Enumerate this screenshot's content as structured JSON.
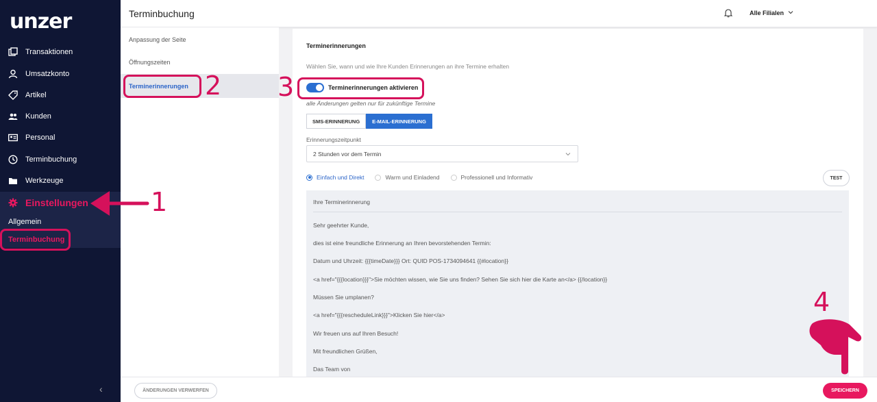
{
  "sidebar": {
    "logo": "unzer",
    "items": [
      {
        "label": "Transaktionen",
        "icon": "transactions-icon"
      },
      {
        "label": "Umsatzkonto",
        "icon": "user-icon"
      },
      {
        "label": "Artikel",
        "icon": "tag-icon"
      },
      {
        "label": "Kunden",
        "icon": "customers-icon"
      },
      {
        "label": "Personal",
        "icon": "id-card-icon"
      },
      {
        "label": "Terminbuchung",
        "icon": "clock-icon"
      },
      {
        "label": "Werkzeuge",
        "icon": "folder-icon"
      },
      {
        "label": "Einstellungen",
        "icon": "gear-icon"
      }
    ],
    "subitems": [
      {
        "label": "Allgemein"
      },
      {
        "label": "Terminbuchung"
      }
    ],
    "collapse_glyph": "‹"
  },
  "header": {
    "title": "Terminbuchung",
    "branch_selector": "Alle Filialen"
  },
  "subnav": {
    "items": [
      {
        "label": "Anpassung der Seite"
      },
      {
        "label": "Öffnungszeiten"
      },
      {
        "label": "Terminerinnerungen"
      }
    ]
  },
  "main": {
    "section_title": "Terminerinnerungen",
    "section_description": "Wählen Sie, wann und wie Ihre Kunden Erinnerungen an ihre Termine erhalten",
    "toggle_label": "Terminerinnerungen aktivieren",
    "toggle_on": true,
    "toggle_note": "alle Änderungen gelten nur für zukünftige Termine",
    "tabs": [
      {
        "label": "SMS-ERINNERUNG"
      },
      {
        "label": "E-MAIL-ERINNERUNG"
      }
    ],
    "timing_label": "Erinnerungszeitpunkt",
    "timing_value": "2 Stunden vor dem Termin",
    "templates": [
      {
        "label": "Einfach und Direkt"
      },
      {
        "label": "Warm und Einladend"
      },
      {
        "label": "Professionell und Informativ"
      }
    ],
    "test_label": "TEST",
    "email": {
      "subject": "Ihre Terminerinnerung",
      "lines": [
        "Sehr geehrter Kunde,",
        "dies ist eine freundliche Erinnerung an Ihren bevorstehenden Termin:",
        "Datum und Uhrzeit: {{{timeDate}}} Ort: QUID POS-1734094641 {{#location}}",
        "<a href=\"{{{location}}}\">Sie möchten wissen, wie Sie uns finden? Sehen Sie sich hier die Karte an</a> {{/location}}",
        "Müssen Sie umplanen?",
        "<a href=\"{{{rescheduleLink}}}\">Klicken Sie hier</a>",
        "Wir freuen uns auf Ihren Besuch!",
        "Mit freundlichen Grüßen,",
        "Das Team von"
      ]
    }
  },
  "footer": {
    "discard_label": "ÄNDERUNGEN VERWERFEN",
    "save_label": "SPEICHERN"
  },
  "annotations": {
    "n1": "1",
    "n2": "2",
    "n3": "3",
    "n4": "4"
  },
  "colors": {
    "sidebar_bg": "#0f1634",
    "accent_pink": "#e8185f",
    "accent_blue": "#2b6fd1"
  }
}
